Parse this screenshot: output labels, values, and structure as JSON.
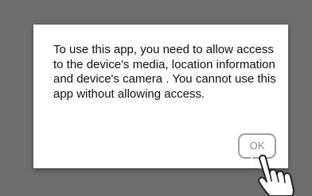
{
  "dialog": {
    "message": "To use this app, you need to allow access to the device's media, location information and device's camera . You cannot use this app without allowing access.",
    "ok_label": "OK"
  },
  "icons": {
    "pointer": "hand-pointer-icon"
  },
  "colors": {
    "backdrop": "#6d6d6d",
    "dialog_bg": "#ffffff",
    "button_border": "#9e9e9e",
    "button_text": "#8a8a8a"
  }
}
